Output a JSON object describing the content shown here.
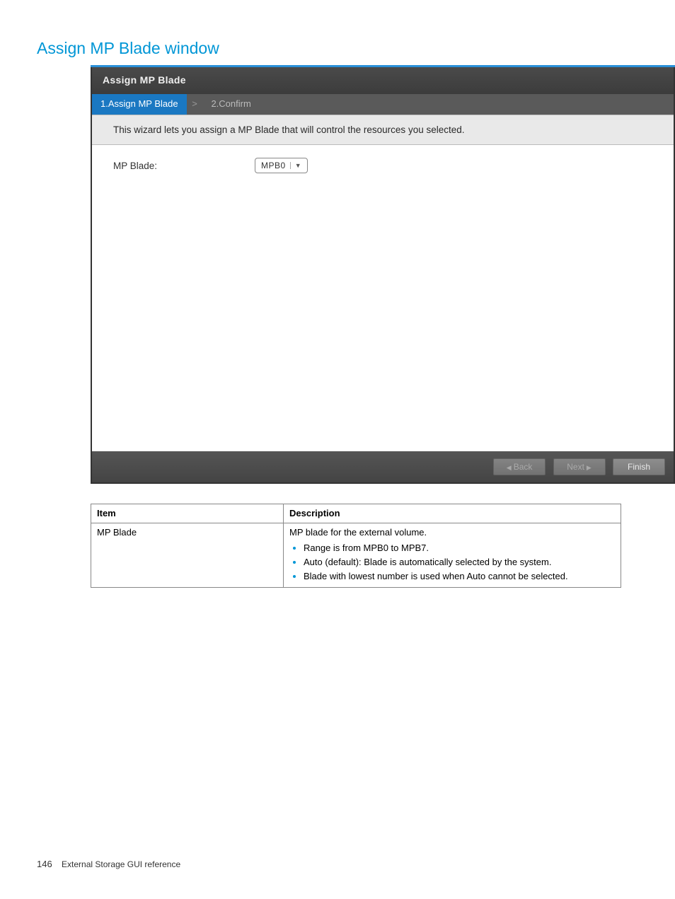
{
  "page": {
    "title": "Assign MP Blade window",
    "number": "146",
    "footer_text": "External Storage GUI reference"
  },
  "wizard": {
    "title": "Assign MP Blade",
    "steps": [
      {
        "label": "1.Assign MP Blade",
        "active": true
      },
      {
        "label": "2.Confirm",
        "active": false
      }
    ],
    "step_sep": ">",
    "intro": "This wizard lets you assign a MP Blade that will control the resources you selected.",
    "field_label": "MP Blade:",
    "select_value": "MPB0",
    "buttons": {
      "back": "Back",
      "next": "Next",
      "finish": "Finish"
    }
  },
  "table": {
    "head": {
      "item": "Item",
      "desc": "Description"
    },
    "rows": [
      {
        "item": "MP Blade",
        "desc_lead": "MP blade for the external volume.",
        "bullets": [
          "Range is from MPB0 to MPB7.",
          "Auto (default): Blade is automatically selected by the system.",
          "Blade with lowest number is used when Auto cannot be selected."
        ]
      }
    ]
  }
}
